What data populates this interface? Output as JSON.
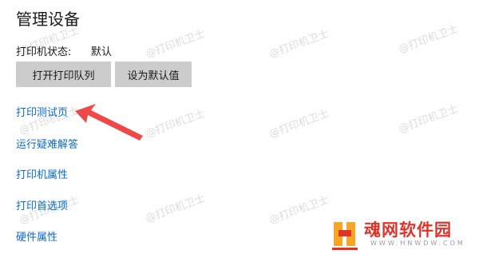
{
  "section": {
    "title": "管理设备"
  },
  "status": {
    "label": "打印机状态:",
    "value": "默认"
  },
  "buttons": {
    "open_queue": "打开打印队列",
    "set_default": "设为默认值"
  },
  "links": [
    {
      "label": "打印测试页"
    },
    {
      "label": "运行疑难解答"
    },
    {
      "label": "打印机属性"
    },
    {
      "label": "打印首选项"
    },
    {
      "label": "硬件属性"
    }
  ],
  "watermark": {
    "text": "@打印机卫士"
  },
  "logo": {
    "cn": "魂网软件园",
    "en": "WWW.HNWDW.COM"
  },
  "colors": {
    "link": "#0b6cc4",
    "button_bg": "#cccccc",
    "arrow": "#f04848",
    "logo_red": "#e0342b",
    "logo_orange": "#f5a623"
  },
  "annotation": {
    "icon": "red-arrow-icon",
    "points_to": "打印测试页"
  }
}
